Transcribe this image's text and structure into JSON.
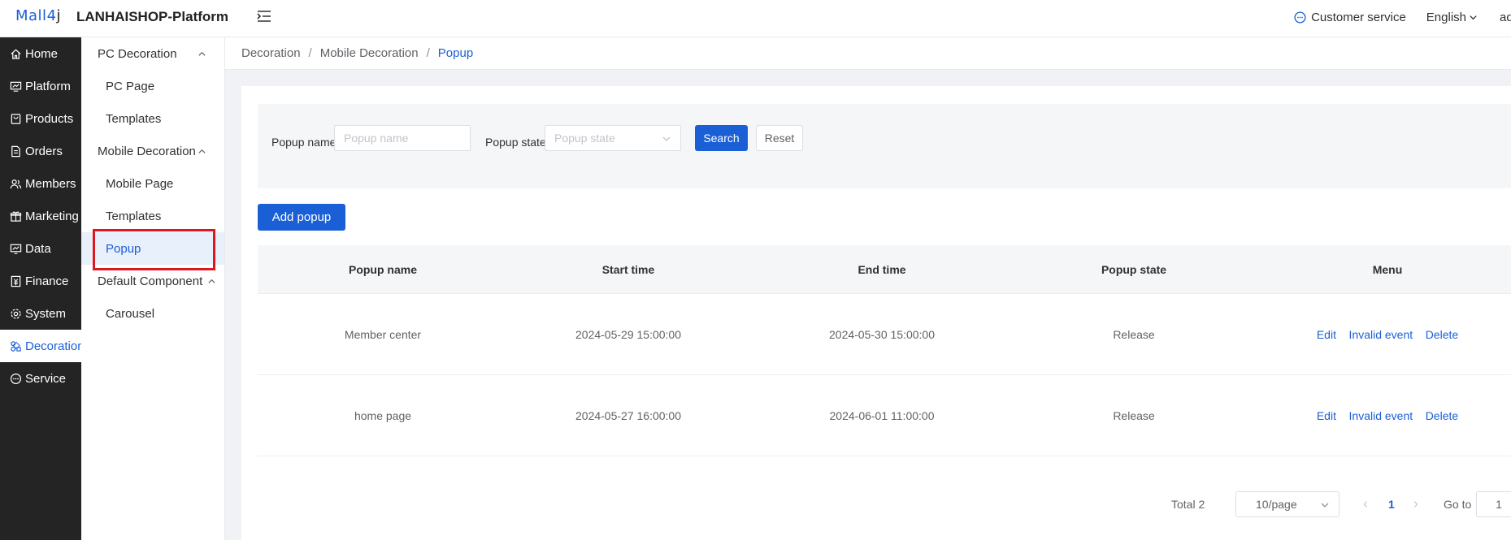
{
  "header": {
    "logo_main": "Mall4",
    "logo_j": "j",
    "brand": "LANHAISHOP-Platform",
    "customer_service": "Customer service",
    "language": "English",
    "user": "ad"
  },
  "nav": {
    "items": [
      {
        "label": "Home",
        "icon": "home-icon"
      },
      {
        "label": "Platform",
        "icon": "monitor-icon"
      },
      {
        "label": "Products",
        "icon": "bag-icon"
      },
      {
        "label": "Orders",
        "icon": "document-icon"
      },
      {
        "label": "Members",
        "icon": "users-icon"
      },
      {
        "label": "Marketing",
        "icon": "gift-icon"
      },
      {
        "label": "Data",
        "icon": "chart-icon"
      },
      {
        "label": "Finance",
        "icon": "finance-icon"
      },
      {
        "label": "System",
        "icon": "gear-icon"
      },
      {
        "label": "Decoration",
        "icon": "decoration-icon"
      },
      {
        "label": "Service",
        "icon": "chat-icon"
      }
    ],
    "active": "Decoration"
  },
  "subnav": {
    "pc_group": "PC Decoration",
    "pc_page": "PC Page",
    "pc_templates": "Templates",
    "mobile_group": "Mobile Decoration",
    "mobile_page": "Mobile Page",
    "mobile_templates": "Templates",
    "popup": "Popup",
    "default_group": "Default Component",
    "carousel": "Carousel"
  },
  "breadcrumb": {
    "level1": "Decoration",
    "level2": "Mobile Decoration",
    "current": "Popup",
    "separator": "/"
  },
  "filter": {
    "name_label": "Popup name",
    "name_placeholder": "Popup name",
    "state_label": "Popup state",
    "state_placeholder": "Popup state",
    "search": "Search",
    "reset": "Reset"
  },
  "add_button": "Add popup",
  "table": {
    "headers": [
      "Popup name",
      "Start time",
      "End time",
      "Popup state",
      "Menu"
    ],
    "rows": [
      {
        "name": "Member center",
        "start": "2024-05-29 15:00:00",
        "end": "2024-05-30 15:00:00",
        "state": "Release"
      },
      {
        "name": "home page",
        "start": "2024-05-27 16:00:00",
        "end": "2024-06-01 11:00:00",
        "state": "Release"
      }
    ],
    "actions": {
      "edit": "Edit",
      "invalid": "Invalid event",
      "delete": "Delete"
    }
  },
  "pagination": {
    "total": "Total 2",
    "page_size": "10/page",
    "current_page": "1",
    "goto_label": "Go to",
    "goto_value": "1"
  },
  "colors": {
    "accent": "#1a5fd6",
    "nav_bg": "#242424",
    "highlight_border": "#e0161e"
  }
}
